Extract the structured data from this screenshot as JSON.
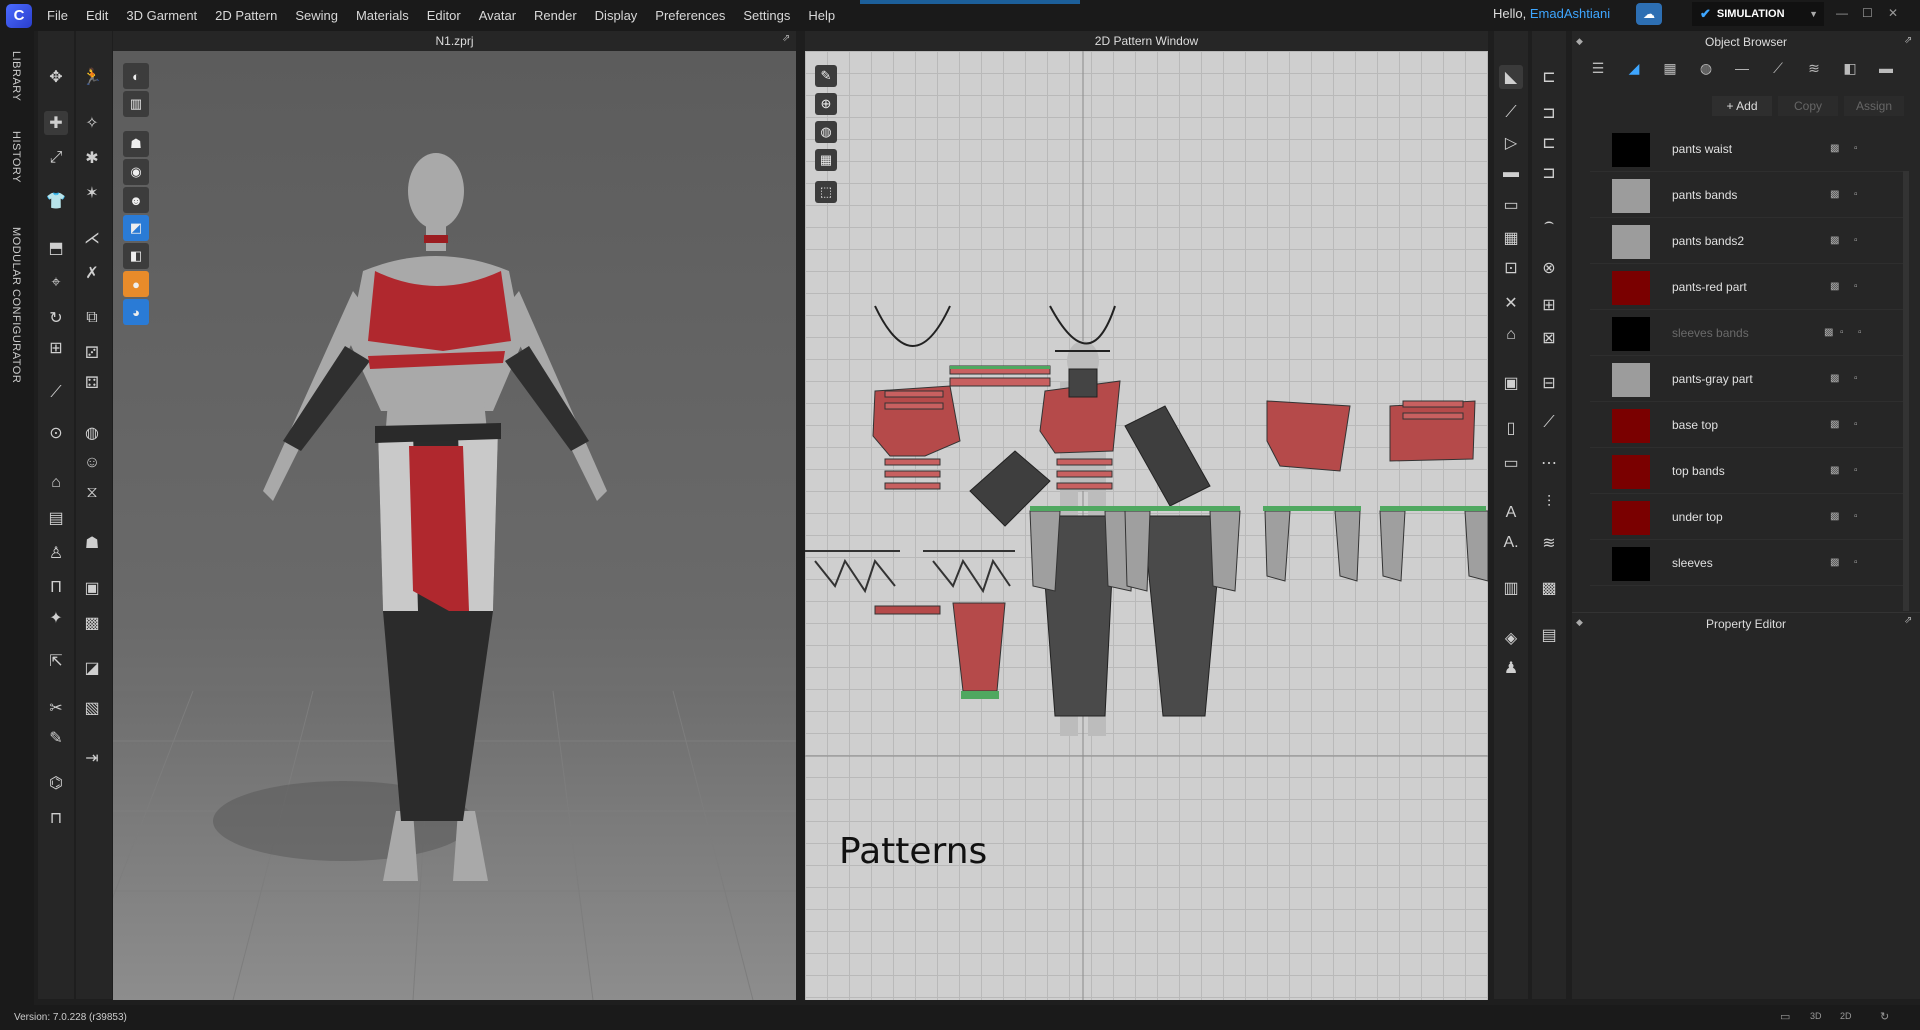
{
  "app": {
    "logo_letter": "C",
    "menu": [
      "File",
      "Edit",
      "3D Garment",
      "2D Pattern",
      "Sewing",
      "Materials",
      "Editor",
      "Avatar",
      "Render",
      "Display",
      "Preferences",
      "Settings",
      "Help"
    ],
    "greeting": "Hello,",
    "username": "EmadAshtiani",
    "mode": "SIMULATION"
  },
  "sidebar_tabs": [
    "LIBRARY",
    "HISTORY",
    "MODULAR CONFIGURATOR"
  ],
  "viewport3d": {
    "title": "N1.zprj"
  },
  "viewport2d": {
    "title": "2D Pattern Window",
    "overlay_text": "Patterns"
  },
  "object_browser": {
    "title": "Object Browser",
    "actions": {
      "add": "+ Add",
      "copy": "Copy",
      "assign": "Assign"
    },
    "fabrics": [
      {
        "name": "pants waist",
        "color": "#000000",
        "dim": false
      },
      {
        "name": "pants bands",
        "color": "#9c9c9c",
        "dim": false
      },
      {
        "name": "pants bands2",
        "color": "#9c9c9c",
        "dim": false
      },
      {
        "name": "pants-red part",
        "color": "#7a0000",
        "dim": false
      },
      {
        "name": "sleeves bands",
        "color": "#000000",
        "dim": true
      },
      {
        "name": "pants-gray part",
        "color": "#9c9c9c",
        "dim": false
      },
      {
        "name": "base top",
        "color": "#7a0000",
        "dim": false
      },
      {
        "name": "top bands",
        "color": "#7a0000",
        "dim": false
      },
      {
        "name": "under top",
        "color": "#7a0000",
        "dim": false
      },
      {
        "name": "sleeves",
        "color": "#000000",
        "dim": false
      }
    ]
  },
  "property_editor": {
    "title": "Property Editor"
  },
  "status": {
    "version": "Version: 7.0.228 (r39853)"
  },
  "colors": {
    "accent": "#3ea6ff",
    "fabric_red": "#b0282e",
    "pattern_red": "#b54a4a",
    "pattern_gray": "#4a4a4a",
    "seam_green": "#4fa860"
  }
}
